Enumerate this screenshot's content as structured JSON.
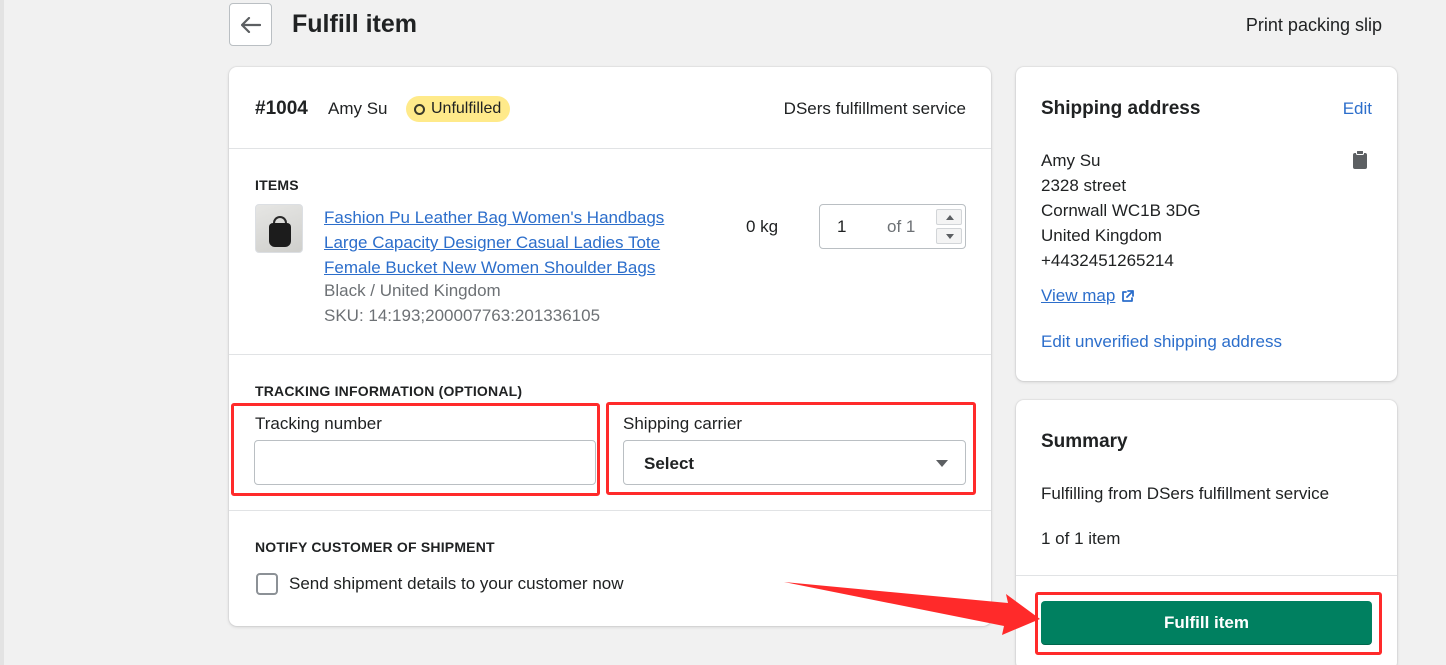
{
  "header": {
    "title": "Fulfill item",
    "print_label": "Print packing slip"
  },
  "order": {
    "number": "#1004",
    "customer": "Amy Su",
    "status": "Unfulfilled",
    "service": "DSers fulfillment service"
  },
  "items": {
    "heading": "ITEMS",
    "product_title_lines": [
      "Fashion Pu Leather Bag Women's Handbags",
      "Large Capacity Designer Casual Ladies Tote",
      "Female Bucket New Women Shoulder Bags"
    ],
    "variant": "Black / United Kingdom",
    "sku": "SKU: 14:193;200007763:201336105",
    "weight": "0 kg",
    "quantity": "1",
    "quantity_of": "of 1"
  },
  "tracking": {
    "heading": "TRACKING INFORMATION (OPTIONAL)",
    "number_label": "Tracking number",
    "number_value": "",
    "carrier_label": "Shipping carrier",
    "carrier_value": "Select"
  },
  "notify": {
    "heading": "NOTIFY CUSTOMER OF SHIPMENT",
    "checkbox_label": "Send shipment details to your customer now",
    "checked": false
  },
  "shipping_address": {
    "title": "Shipping address",
    "edit_label": "Edit",
    "lines": [
      "Amy Su",
      "2328 street",
      "Cornwall WC1B 3DG",
      "United Kingdom",
      "+4432451265214"
    ],
    "view_map_label": "View map",
    "edit_unverified_label": "Edit unverified shipping address"
  },
  "summary": {
    "title": "Summary",
    "from_text": "Fulfilling from DSers fulfillment service",
    "count_text": "1 of 1 item",
    "fulfill_label": "Fulfill item"
  },
  "colors": {
    "primary_button": "#008060",
    "link": "#2c6ecb",
    "badge": "#ffea8a",
    "annotation": "#ff2a2a"
  },
  "icons": {
    "back": "arrow-left-icon",
    "clipboard": "clipboard-icon",
    "external": "external-link-icon",
    "caret": "caret-down-icon"
  }
}
